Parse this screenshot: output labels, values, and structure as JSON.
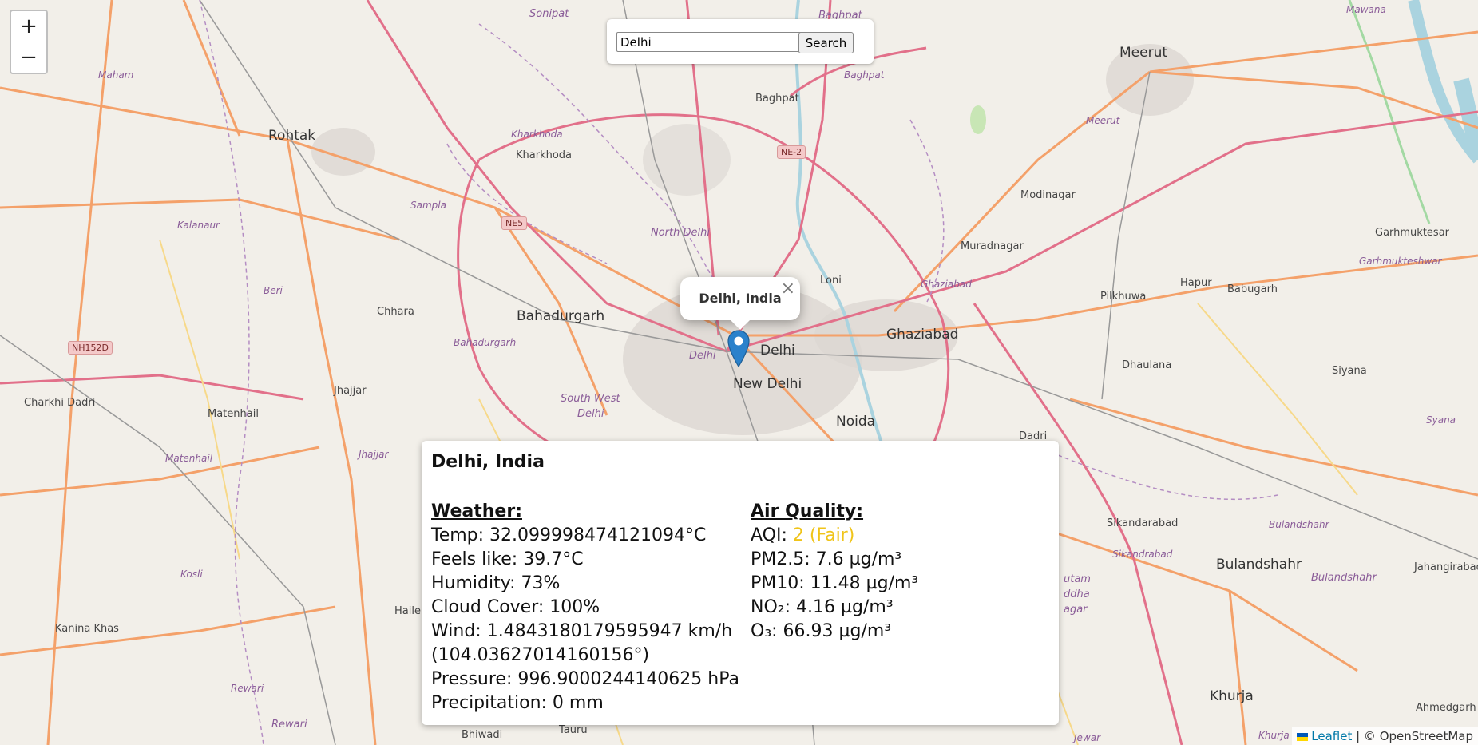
{
  "search": {
    "value": "Delhi",
    "button_label": "Search"
  },
  "zoom": {
    "in_label": "+",
    "out_label": "−"
  },
  "marker_popup": {
    "title": "Delhi, India",
    "close_label": "×"
  },
  "info_panel": {
    "title": "Delhi, India",
    "weather_header": "Weather:",
    "temp": "Temp: 32.099998474121094°C",
    "feels_like": "Feels like: 39.7°C",
    "humidity": "Humidity: 73%",
    "cloud_cover": "Cloud Cover: 100%",
    "wind": "Wind: 1.4843180179595947 km/h (104.03627014160156°)",
    "pressure": "Pressure: 996.9000244140625 hPa",
    "precipitation": "Precipitation: 0 mm",
    "air_header": "Air Quality:",
    "aqi_label": "AQI: ",
    "aqi_value": "2 (Fair)",
    "aqi_color": "#f0c419",
    "pm25": "PM2.5: 7.6 µg/m³",
    "pm10": "PM10: 11.48 µg/m³",
    "no2": "NO₂: 4.16 µg/m³",
    "o3": "O₃: 66.93 µg/m³"
  },
  "attribution": {
    "leaflet": "Leaflet",
    "rest": " | © OpenStreetMap"
  },
  "places": {
    "sonipat": "Sonipat",
    "baghpat_top": "Baghpat",
    "meerut": "Meerut",
    "mawana": "Mawana",
    "maham": "Maham",
    "baghpat_d": "Baghpat",
    "baghpat": "Baghpat",
    "meerut_d": "Meerut",
    "rohtak": "Rohtak",
    "kharkhoda_d": "Kharkhoda",
    "kharkhoda": "Kharkhoda",
    "modinagar": "Modinagar",
    "sampla": "Sampla",
    "kalanaur": "Kalanaur",
    "north_delhi": "North Delhi",
    "garhmuktesar": "Garhmuktesar",
    "garhmukteshwar": "Garhmukteshwar",
    "muradnagar": "Muradnagar",
    "beri": "Beri",
    "loni": "Loni",
    "ghaziabad_d": "Ghaziabad",
    "hapur": "Hapur",
    "babugarh": "Babugarh",
    "pilkhuwa": "Pilkhuwa",
    "bahadurgarh": "Bahadurgarh",
    "chhara": "Chhara",
    "bahadurgarh_d": "Bahadurgarh",
    "ghaziabad": "Ghaziabad",
    "delhi": "Delhi",
    "delhi_d": "Delhi",
    "new_delhi": "New Delhi",
    "dhaulana": "Dhaulana",
    "siyana": "Siyana",
    "jhajjar": "Jhajjar",
    "charkhi_dadri": "Charkhi Dadri",
    "south_west_delhi": "South West",
    "south_west_delhi2": "Delhi",
    "noida": "Noida",
    "matenhail": "Matenhail",
    "syana": "Syana",
    "dadri": "Dadri",
    "matenhail_d": "Matenhail",
    "jhajjar_d": "Jhajjar",
    "sikandarabad": "Sikandarabad",
    "sikandarabad_d": "Sikandrabad",
    "bulandshahr_d": "Bulandshahr",
    "bulandshahr": "Bulandshahr",
    "bulandshahr2": "Bulandshahr",
    "jahangirabad": "Jahangirabad",
    "kosli": "Kosli",
    "kanina": "Kanina Khas",
    "haile": "Haile",
    "gautam1": "utam",
    "gautam2": "ddha",
    "gautam3": "agar",
    "rewari_d": "Rewari",
    "rewari": "Rewari",
    "khurja": "Khurja",
    "ahmedgarh": "Ahmedgarh",
    "bhiwadi": "Bhiwadi",
    "tauru": "Tauru",
    "khurja_d": "Khurja",
    "jewar": "Jewar"
  },
  "shields": {
    "ne2": "NE-2",
    "ne5": "NE5",
    "nh152d": "NH152D"
  }
}
